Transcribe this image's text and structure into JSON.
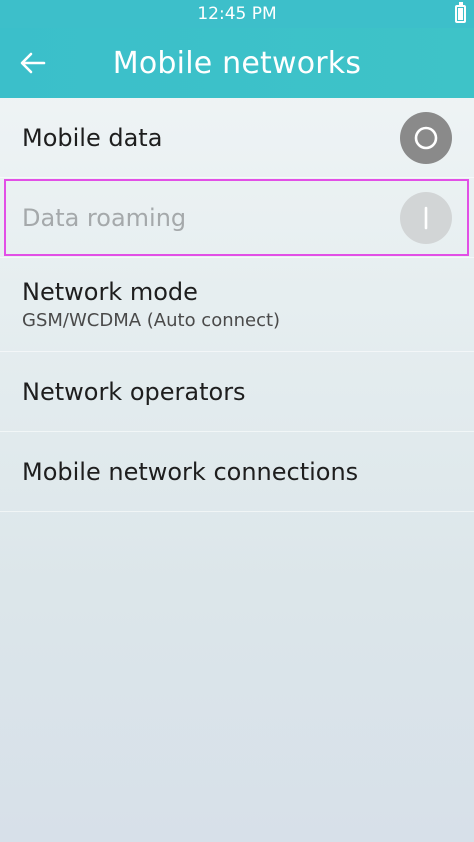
{
  "status_bar": {
    "time": "12:45 PM",
    "battery_icon": "battery-icon"
  },
  "header": {
    "title": "Mobile networks",
    "back_icon": "arrow-left-icon"
  },
  "colors": {
    "header": "#3bbfca",
    "toggle_off": "#8a8a8a",
    "toggle_disabled": "#d2d5d6",
    "highlight": "#e24fe6"
  },
  "settings": [
    {
      "label": "Mobile data",
      "toggle": "off"
    },
    {
      "label": "Data roaming",
      "toggle": "off",
      "disabled": true
    },
    {
      "label": "Network mode",
      "value": "GSM/WCDMA (Auto connect)"
    },
    {
      "label": "Network operators"
    },
    {
      "label": "Mobile network connections"
    }
  ]
}
